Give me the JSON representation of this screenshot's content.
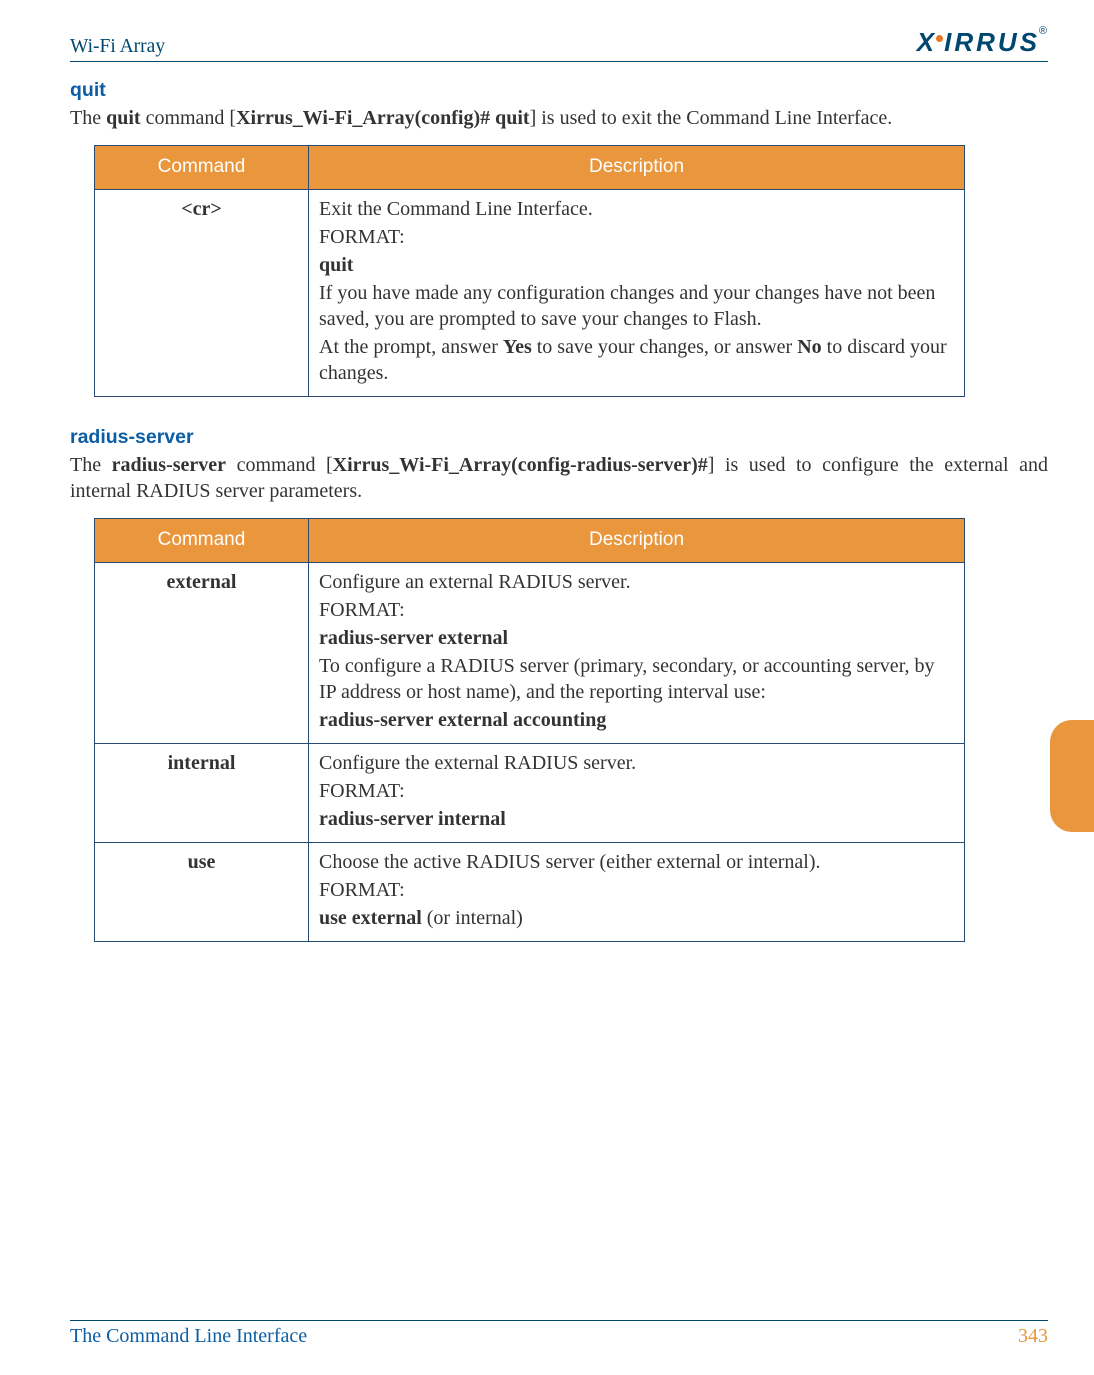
{
  "header": {
    "title": "Wi-Fi Array",
    "brand": "XIRRUS",
    "reg": "®"
  },
  "sections": {
    "quit": {
      "heading": "quit",
      "intro_pre": "The ",
      "cmd": "quit",
      "intro_mid": " command [",
      "prompt": "Xirrus_Wi-Fi_Array(config)# quit",
      "intro_post": "] is used to exit the Command Line Interface.",
      "table": {
        "headers": {
          "c1": "Command",
          "c2": "Description"
        },
        "rows": [
          {
            "cmd": "<cr>",
            "lines": {
              "l1": "Exit the Command Line Interface.",
              "fmt": "FORMAT:",
              "kw": "quit",
              "l2": "If you have made any configuration changes and your changes have not been saved, you are prompted to save your changes to Flash.",
              "l3_pre": "At the prompt, answer ",
              "l3_yes": "Yes",
              "l3_mid": " to save your changes, or answer ",
              "l3_no": "No",
              "l3_post": " to discard your changes."
            }
          }
        ]
      }
    },
    "radius": {
      "heading": "radius-server",
      "intro_pre": "The ",
      "cmd": "radius-server",
      "intro_mid": " command [",
      "prompt": "Xirrus_Wi-Fi_Array(config-radius-server)#",
      "intro_post": "] is used to configure the external and internal RADIUS server parameters.",
      "table": {
        "headers": {
          "c1": "Command",
          "c2": "Description"
        },
        "rows": [
          {
            "cmd": "external",
            "lines": {
              "l1": "Configure an external RADIUS server.",
              "fmt": "FORMAT:",
              "kw": "radius-server external",
              "l2": "To configure a RADIUS server (primary, secondary, or accounting server, by IP address or host name), and the reporting interval use:",
              "kw2": "radius-server external accounting"
            }
          },
          {
            "cmd": "internal",
            "lines": {
              "l1": "Configure the external RADIUS server.",
              "fmt": "FORMAT:",
              "kw": "radius-server internal"
            }
          },
          {
            "cmd": "use",
            "lines": {
              "l1": "Choose the active RADIUS server (either external or internal).",
              "fmt": "FORMAT:",
              "kw_pre": "use external",
              "kw_post": " (or internal)"
            }
          }
        ]
      }
    }
  },
  "footer": {
    "left": "The Command Line Interface",
    "right": "343"
  }
}
